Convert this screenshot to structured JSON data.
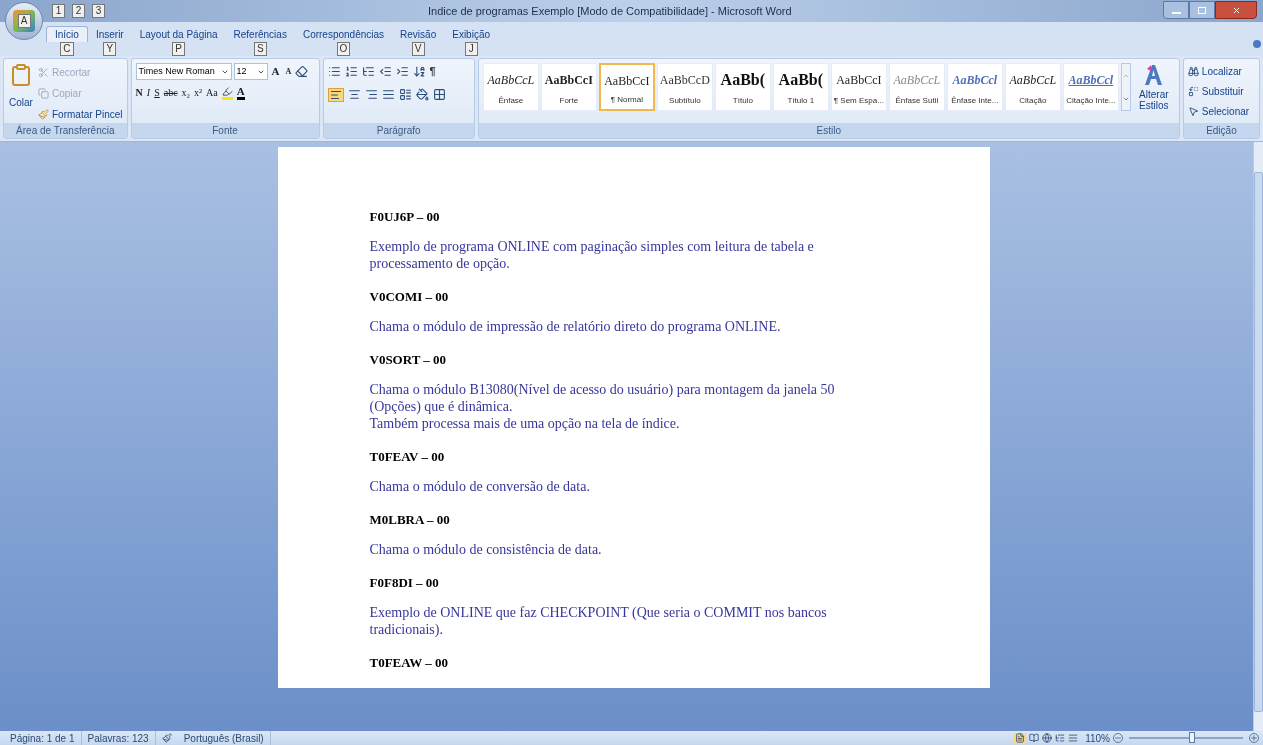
{
  "window": {
    "title": "Indice de programas Exemplo [Modo de Compatibilidade] - Microsoft Word",
    "office_key_tip": "A",
    "quick_access_key_tips": [
      "1",
      "2",
      "3"
    ]
  },
  "tabs": [
    {
      "label": "Início",
      "key_tip": "C",
      "selected": true
    },
    {
      "label": "Inserir",
      "key_tip": "Y",
      "selected": false
    },
    {
      "label": "Layout da Página",
      "key_tip": "P",
      "selected": false
    },
    {
      "label": "Referências",
      "key_tip": "S",
      "selected": false
    },
    {
      "label": "Correspondências",
      "key_tip": "O",
      "selected": false
    },
    {
      "label": "Revisão",
      "key_tip": "V",
      "selected": false
    },
    {
      "label": "Exibição",
      "key_tip": "J",
      "selected": false
    }
  ],
  "clipboard": {
    "title": "Área de Transferência",
    "paste": "Colar",
    "items": [
      {
        "label": "Recortar",
        "disabled": true
      },
      {
        "label": "Copiar",
        "disabled": true
      },
      {
        "label": "Formatar Pincel",
        "disabled": false
      }
    ]
  },
  "font": {
    "title": "Fonte",
    "font_name": "Times New Roman",
    "font_size": "12",
    "buttons": [
      "N",
      "I",
      "S",
      "abc",
      "x₂",
      "x²",
      "Aa"
    ],
    "grow": "A",
    "shrink": "A",
    "color_letter": "A"
  },
  "paragraph": {
    "title": "Parágrafo",
    "show_marks": "¶"
  },
  "styles": {
    "title": "Estilo",
    "items": [
      {
        "sample": "AaBbCcL",
        "label": "Ênfase",
        "kind": "emphasis",
        "selected": false
      },
      {
        "sample": "AaBbCcI",
        "label": "Forte",
        "kind": "strong",
        "selected": false
      },
      {
        "sample": "AaBbCcI",
        "label": "¶ Normal",
        "kind": "normal",
        "selected": true
      },
      {
        "sample": "AaBbCcD",
        "label": "Subtítulo",
        "kind": "subtitle",
        "selected": false
      },
      {
        "sample": "AaBb(",
        "label": "Título",
        "kind": "title",
        "selected": false
      },
      {
        "sample": "AaBb(",
        "label": "Título 1",
        "kind": "heading",
        "selected": false
      },
      {
        "sample": "AaBbCcI",
        "label": "¶ Sem Espa...",
        "kind": "normal",
        "selected": false
      },
      {
        "sample": "AaBbCcL",
        "label": "Ênfase Sutil",
        "kind": "subtle",
        "selected": false
      },
      {
        "sample": "AaBbCcl",
        "label": "Ênfase Inte...",
        "kind": "intense",
        "selected": false
      },
      {
        "sample": "AaBbCcL",
        "label": "Citação",
        "kind": "quote",
        "selected": false
      },
      {
        "sample": "AaBbCcl",
        "label": "Citação Inte...",
        "kind": "intense-quote",
        "selected": false
      }
    ],
    "change_styles": "Alterar Estilos"
  },
  "editing": {
    "title": "Edição",
    "items": [
      "Localizar",
      "Substituir",
      "Selecionar"
    ]
  },
  "document": {
    "entries": [
      {
        "code": "F0UJ6P – 00",
        "lines": [
          "Exemplo de programa ONLINE com paginação simples com leitura de tabela e processamento de opção."
        ]
      },
      {
        "code": "V0COMI – 00",
        "lines": [
          "Chama o módulo de impressão de relatório direto do programa ONLINE."
        ]
      },
      {
        "code": "V0SORT – 00",
        "lines": [
          "Chama o módulo B13080(Nível de acesso do usuário) para montagem da janela 50 (Opções) que é dinâmica.",
          "Também processa mais de uma opção na tela de índice."
        ]
      },
      {
        "code": "T0FEAV – 00",
        "lines": [
          "Chama o módulo de conversão de data."
        ]
      },
      {
        "code": "M0LBRA – 00",
        "lines": [
          "Chama o módulo de consistência de data."
        ]
      },
      {
        "code": "F0F8DI – 00",
        "lines": [
          "Exemplo de ONLINE que faz CHECKPOINT (Que seria o COMMIT nos bancos tradicionais)."
        ]
      },
      {
        "code": "T0FEAW – 00"
      }
    ]
  },
  "status_bar": {
    "page": "Página: 1 de 1",
    "words": "Palavras: 123",
    "language": "Português (Brasil)",
    "zoom": "110%",
    "zoom_level": {
      "level": 0.55
    }
  }
}
